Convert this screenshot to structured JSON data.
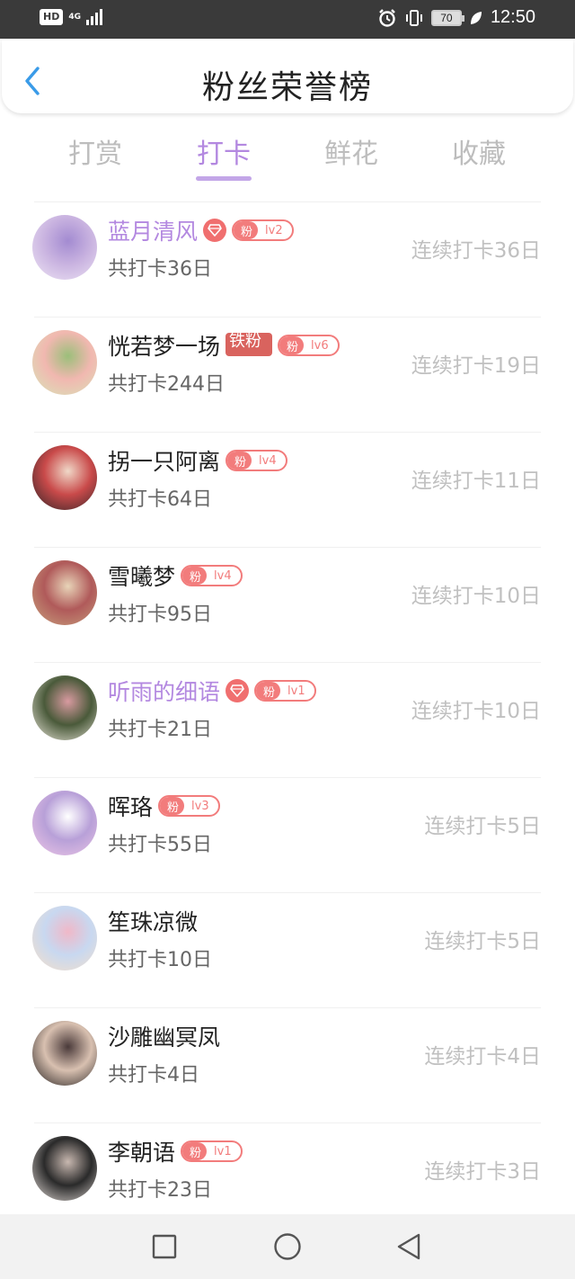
{
  "status_bar": {
    "hd": "HD",
    "net": "4G",
    "battery": "70",
    "time": "12:50"
  },
  "header": {
    "title": "粉丝荣誉榜"
  },
  "tabs": [
    {
      "label": "打赏"
    },
    {
      "label": "打卡"
    },
    {
      "label": "鲜花"
    },
    {
      "label": "收藏"
    }
  ],
  "active_tab": "打卡",
  "fans": [
    {
      "name": "蓝月清风",
      "vip": true,
      "fan_label": "粉",
      "level": "lv2",
      "total": "共打卡36日",
      "streak": "连续打卡36日",
      "avatar_colors": [
        "#efe6f5",
        "#c9b3e0",
        "#a38bd1"
      ]
    },
    {
      "name": "恍若梦一场",
      "vip": false,
      "tie": "铁粉",
      "fan_label": "粉",
      "level": "lv6",
      "total": "共打卡244日",
      "streak": "连续打卡19日",
      "avatar_colors": [
        "#d7e6b8",
        "#f1b8b0",
        "#9bbf7a"
      ]
    },
    {
      "name": "拐一只阿离",
      "vip": false,
      "fan_label": "粉",
      "level": "lv4",
      "total": "共打卡64日",
      "streak": "连续打卡11日",
      "avatar_colors": [
        "#2a2326",
        "#c94a4a",
        "#f0d8c8"
      ]
    },
    {
      "name": "雪曦梦",
      "vip": false,
      "fan_label": "粉",
      "level": "lv4",
      "total": "共打卡95日",
      "streak": "连续打卡10日",
      "avatar_colors": [
        "#c8a47e",
        "#b05a5a",
        "#e8d4b8"
      ]
    },
    {
      "name": "听雨的细语",
      "vip": true,
      "fan_label": "粉",
      "level": "lv1",
      "total": "共打卡21日",
      "streak": "连续打卡10日",
      "avatar_colors": [
        "#f0ebe0",
        "#4a5a3a",
        "#d89aa0"
      ]
    },
    {
      "name": "晖珞",
      "vip": false,
      "fan_label": "粉",
      "level": "lv3",
      "total": "共打卡55日",
      "streak": "连续打卡5日",
      "avatar_colors": [
        "#f0c8e6",
        "#b8a0d8",
        "#ffffff"
      ]
    },
    {
      "name": "笙珠凉微",
      "vip": false,
      "total": "共打卡10日",
      "streak": "连续打卡5日",
      "avatar_colors": [
        "#f8e0c8",
        "#c8d8f0",
        "#f0b8c8"
      ]
    },
    {
      "name": "沙雕幽冥凤",
      "vip": false,
      "total": "共打卡4日",
      "streak": "连续打卡4日",
      "avatar_colors": [
        "#1e1a1a",
        "#d8c0b0",
        "#4a3a3a"
      ]
    },
    {
      "name": "李朝语",
      "vip": false,
      "fan_label": "粉",
      "level": "lv1",
      "total": "共打卡23日",
      "streak": "连续打卡3日",
      "avatar_colors": [
        "#e8e0dc",
        "#2a2a2a",
        "#c8b8b0"
      ]
    }
  ],
  "colors": {
    "accent": "#b388e0",
    "badge": "#f27c7c",
    "streak": "#c0c0c0"
  },
  "nav": [
    "recent-apps",
    "home",
    "back"
  ]
}
